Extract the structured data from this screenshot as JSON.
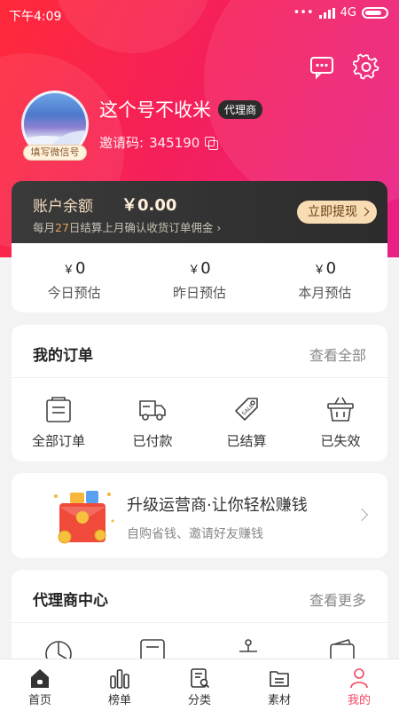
{
  "status_bar": {
    "time": "下午4:09",
    "network": "4G"
  },
  "profile": {
    "nickname": "这个号不收米",
    "role_badge": "代理商",
    "invite_label": "邀请码:",
    "invite_code": "345190",
    "wechat_badge": "填写微信号"
  },
  "balance": {
    "label": "账户余额",
    "amount": "￥0.00",
    "note_prefix": "每月",
    "note_day": "27",
    "note_suffix": "日结算上月确认收货订单佣金",
    "withdraw_label": "立即提现"
  },
  "estimates": [
    {
      "currency": "￥",
      "value": "0",
      "label": "今日预估"
    },
    {
      "currency": "￥",
      "value": "0",
      "label": "昨日预估"
    },
    {
      "currency": "￥",
      "value": "0",
      "label": "本月预估"
    }
  ],
  "orders": {
    "title": "我的订单",
    "view_all": "查看全部",
    "items": [
      {
        "label": "全部订单",
        "icon": "order-list-icon"
      },
      {
        "label": "已付款",
        "icon": "truck-icon"
      },
      {
        "label": "已结算",
        "icon": "sale-tag-icon"
      },
      {
        "label": "已失效",
        "icon": "basket-icon"
      }
    ]
  },
  "promo": {
    "title": "升级运营商·让你轻松赚钱",
    "subtitle": "自购省钱、邀请好友赚钱"
  },
  "agent_center": {
    "title": "代理商中心",
    "view_more": "查看更多"
  },
  "tabbar": [
    {
      "label": "首页",
      "icon": "home-icon"
    },
    {
      "label": "榜单",
      "icon": "chart-icon"
    },
    {
      "label": "分类",
      "icon": "category-icon"
    },
    {
      "label": "素材",
      "icon": "folder-icon"
    },
    {
      "label": "我的",
      "icon": "person-icon",
      "active": true
    }
  ],
  "colors": {
    "accent": "#f5455e",
    "hero_start": "#ff2a3a",
    "hero_end": "#e81f86",
    "gold": "#f7dcb4"
  }
}
